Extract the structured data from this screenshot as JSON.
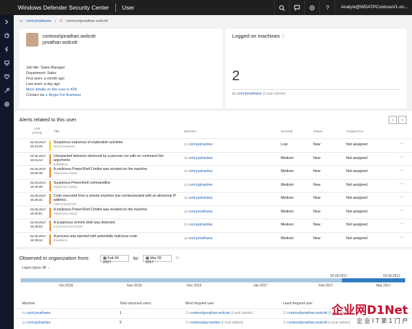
{
  "header": {
    "app_title": "Windows Defender Security Center",
    "section": "User",
    "user": "Analyst@WDATPContosoV1.on..."
  },
  "breadcrumb": {
    "host": "cont-jonathane",
    "user": "contoso\\jonathan.wolcott"
  },
  "user_card": {
    "account": "contoso\\jonathan.wolcott",
    "display_name": "jonathan wolcott",
    "job_title": "Job title: Sales Manager",
    "department": "Department: Sales",
    "first_seen": "First seen: a month ago",
    "last_seen": "Last seen: a day ago",
    "ata_link": "More details on this user in ATA",
    "contact_prefix": "Contact via",
    "contact_link": "Skype For Business"
  },
  "logged_on": {
    "title": "Logged on machines",
    "count": "2",
    "machine": "cont-jonathane",
    "role": "(Local admin)"
  },
  "alerts": {
    "title": "Alerts related to this user",
    "columns": {
      "last_activity": "Last activity",
      "title": "Title",
      "machine": "Machine",
      "severity": "Severity",
      "status": "Status",
      "assigned": "Assigned to"
    },
    "rows": [
      {
        "date": "02.06.2017",
        "time": "16:41:29",
        "title": "Suspicious sequence of exploration activities",
        "category": "Reconnaissance",
        "machine": "cont-jayhardee",
        "severity": "Low",
        "status": "New",
        "assigned": "Not assigned",
        "color": "#f2c811"
      },
      {
        "date": "02.06.2017",
        "time": "16:41:13",
        "title": "Unexpected behavior observed by a process run with no command line arguments",
        "category": "Installation",
        "machine": "cont-jayhardee",
        "severity": "Medium",
        "status": "New",
        "assigned": "Not assigned",
        "color": "#e8831a"
      },
      {
        "date": "02.06.2017",
        "time": "16:40:48",
        "title": "A malicious PowerShell Cmdlet was invoked on the machine.",
        "category": "Suspicious Activity",
        "machine": "cont-jayhardee",
        "severity": "Medium",
        "status": "New",
        "assigned": "Not assigned",
        "color": "#e8831a"
      },
      {
        "date": "02.06.2017",
        "time": "16:40:39",
        "title": "Suspicious Powershell commandline",
        "category": "Suspicious Activity",
        "machine": "cont-jayhardee",
        "severity": "Medium",
        "status": "New",
        "assigned": "Not assigned",
        "color": "#e8831a"
      },
      {
        "date": "02.06.2017",
        "time": "16:40:32",
        "title": "Code executed from a remote machine has communicated with an abnormal IP address.",
        "category": "Lateral Movement",
        "machine": "cont-jayhardee",
        "severity": "Medium",
        "status": "New",
        "assigned": "Not assigned",
        "color": "#e8831a"
      },
      {
        "date": "02.06.2017",
        "time": "16:40:51",
        "title": "A malicious PowerShell Cmdlet was invoked on the machine.",
        "category": "Suspicious Activity",
        "machine": "cont-jonathane",
        "severity": "Medium",
        "status": "New",
        "assigned": "Not assigned",
        "color": "#e8831a"
      },
      {
        "date": "02.06.2017",
        "time": "16:39:52",
        "title": "A suspicious remote shell was detected.",
        "category": "Command And Control",
        "machine": "cont-jayhardee",
        "severity": "Medium",
        "status": "New",
        "assigned": "Not assigned",
        "color": "#e8831a"
      },
      {
        "date": "02.06.2017",
        "time": "16:39:12",
        "title": "A process was injected with potentially malicious code",
        "category": "Installation",
        "machine": "cont-jonathane",
        "severity": "Medium",
        "status": "New",
        "assigned": "Not assigned",
        "color": "#e8831a"
      }
    ]
  },
  "observed": {
    "title": "Observed in organization from:",
    "from": "Feb 09 2017",
    "to_label": "to:",
    "to": "Mar 09 2017",
    "logon_types": "Logon types: All",
    "range_start": "02.09.2017",
    "range_end": "03.09.2017",
    "months": [
      "Oct 2016",
      "Nov 2016",
      "Dec 2016",
      "Jan 2017",
      "Feb 2017",
      "Mar 2017"
    ],
    "columns": {
      "machine": "Machine",
      "total_users": "Total observed users",
      "most_frequent": "Most frequent user",
      "least_frequent": "Least frequent user"
    },
    "rows": [
      {
        "machine": "cont-jonathane",
        "total": "1",
        "most": "contoso\\jonathan.wolcott",
        "most_role": "(Local admin)",
        "least": "contoso\\jonathan.wolcott",
        "least_role": "(Local admin)"
      },
      {
        "machine": "cont-jayhardee",
        "total": "2",
        "most": "contoso\\jay.hardee",
        "most_role": "(Local admin)",
        "least": "contoso\\jonathan.wolcott",
        "least_role": "(Local admin)"
      }
    ]
  },
  "watermark": {
    "text": "企业网D1Net",
    "sub": "企 业 I T 第 1 门 户"
  }
}
